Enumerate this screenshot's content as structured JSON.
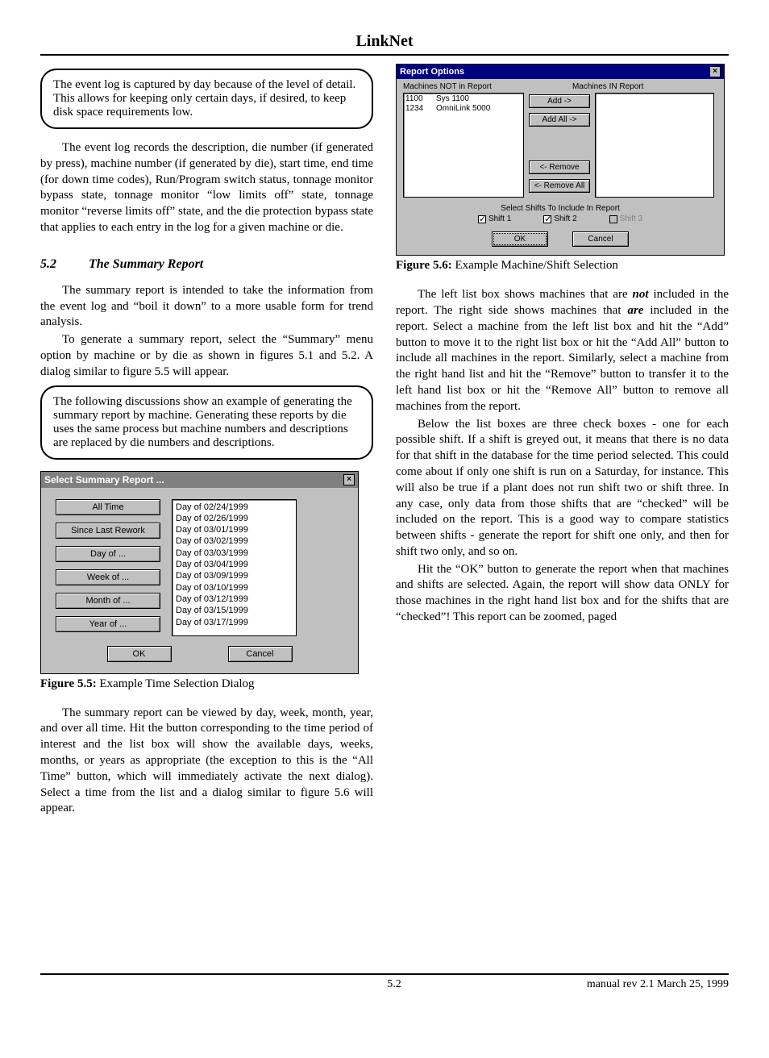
{
  "header": {
    "title": "LinkNet"
  },
  "footer": {
    "page": "5.2",
    "rev": "manual rev 2.1     March 25, 1999"
  },
  "section52": {
    "num": "5.2",
    "title": "The Summary Report"
  },
  "callout1": "The event log is captured by day because of the level of detail.  This allows for keeping only certain days, if desired, to keep disk space requirements low.",
  "para1": "The event log records the description, die number (if generated by press), machine number (if generated by die), start time, end time (for down time codes),  Run/Program switch status, tonnage monitor bypass state, tonnage monitor “low limits off” state, tonnage monitor “reverse limits off” state, and the die protection bypass state that applies to each entry in the log for a given machine or die.",
  "para2": "The summary report is intended to take the information from the event log and “boil it down” to a more usable form for trend analysis.",
  "para3": "To generate a summary report, select the “Summary” menu option by machine or by die as shown in figures 5.1 and 5.2.  A dialog similar to figure 5.5 will appear.",
  "callout2": "The following discussions show an example of generating the summary report by machine.  Generating these reports by die uses the same process but machine numbers and descriptions are replaced by die numbers and descriptions.",
  "fig55": {
    "label": "Figure 5.5:",
    "text": " Example Time Selection Dialog"
  },
  "fig56": {
    "label": "Figure 5.6:",
    "text": " Example Machine/Shift Selection"
  },
  "para4": "The summary report can be viewed by day, week, month, year, and over all time.  Hit the button corresponding to the time period of interest and the list box will show the available days, weeks, months, or years as appropriate (the exception to this is the “All Time” button, which will immediately activate the next dialog).  Select a time from the list and a dialog similar to figure 5.6 will appear.",
  "para5a": "The left list box shows machines that are ",
  "para5b": "not",
  "para5c": " included in the report.  The right side shows machines that ",
  "para5d": "are",
  "para5e": " included in the report.  Select a machine from the left list box and hit the “Add” button to move it to the right list box or hit the “Add All” button to include all machines in the report.  Similarly, select a machine from the right hand list and hit the “Remove” button to transfer it to the left hand list box or hit the “Remove All” button to remove all machines from the report. ",
  "para6": "Below the list boxes are three check boxes - one for each possible shift.  If a shift is greyed out, it means that there is no data for that shift in the database for the time period selected.  This could come about if only one shift is run on a Saturday, for instance.  This will also be true if a plant does not run shift two or shift three.  In any case, only data from those shifts that are “checked” will be included on the report.  This is a good way to compare statistics between shifts - generate the report for shift one only, and then for shift two only, and so on.",
  "para7": "Hit the “OK” button to generate the report when that machines and shifts are selected.  Again, the report will show data ONLY for those machines in the right hand list box and for the shifts that are “checked”!  This report can be zoomed, paged",
  "dlg55": {
    "title": "Select Summary Report ...",
    "buttons": [
      "All Time",
      "Since Last Rework",
      "Day of ...",
      "Week of ...",
      "Month of ...",
      "Year of ..."
    ],
    "list": [
      "Day of 02/24/1999",
      "Day of 02/26/1999",
      "Day of 03/01/1999",
      "Day of 03/02/1999",
      "Day of 03/03/1999",
      "Day of 03/04/1999",
      "Day of 03/09/1999",
      "Day of 03/10/1999",
      "Day of 03/12/1999",
      "Day of 03/15/1999",
      "Day of 03/17/1999"
    ],
    "ok": "OK",
    "cancel": "Cancel"
  },
  "dlg56": {
    "title": "Report Options",
    "leftLabel": "Machines NOT in Report",
    "rightLabel": "Machines IN Report",
    "leftList": [
      {
        "id": "1100",
        "desc": "Sys 1100"
      },
      {
        "id": "1234",
        "desc": "OmniLink 5000"
      }
    ],
    "btns": {
      "add": "Add ->",
      "addAll": "Add All ->",
      "remove": "<- Remove",
      "removeAll": "<- Remove All"
    },
    "shiftsLabel": "Select Shifts To Include In Report",
    "shifts": [
      {
        "label": "Shift 1",
        "checked": true,
        "enabled": true
      },
      {
        "label": "Shift 2",
        "checked": true,
        "enabled": true
      },
      {
        "label": "Shift 3",
        "checked": false,
        "enabled": false
      }
    ],
    "ok": "OK",
    "cancel": "Cancel"
  }
}
